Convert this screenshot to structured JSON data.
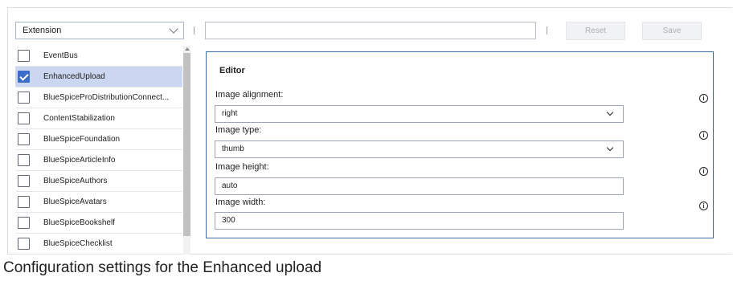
{
  "toolbar": {
    "select_value": "Extension",
    "search_value": "",
    "reset_label": "Reset",
    "save_label": "Save"
  },
  "list": {
    "items": [
      {
        "label": "EventBus",
        "checked": false
      },
      {
        "label": "EnhancedUpload",
        "checked": true
      },
      {
        "label": "BlueSpiceProDistributionConnect...",
        "checked": false
      },
      {
        "label": "ContentStabilization",
        "checked": false
      },
      {
        "label": "BlueSpiceFoundation",
        "checked": false
      },
      {
        "label": "BlueSpiceArticleInfo",
        "checked": false
      },
      {
        "label": "BlueSpiceAuthors",
        "checked": false
      },
      {
        "label": "BlueSpiceAvatars",
        "checked": false
      },
      {
        "label": "BlueSpiceBookshelf",
        "checked": false
      },
      {
        "label": "BlueSpiceChecklist",
        "checked": false
      }
    ]
  },
  "editor": {
    "title": "Editor",
    "fields": [
      {
        "label": "Image alignment:",
        "value": "right",
        "type": "dropdown"
      },
      {
        "label": "Image type:",
        "value": "thumb",
        "type": "dropdown"
      },
      {
        "label": "Image height:",
        "value": "auto",
        "type": "text"
      },
      {
        "label": "Image width:",
        "value": "300",
        "type": "text"
      }
    ],
    "info_icon": "info-circle-icon"
  },
  "caption": "Configuration settings for the Enhanced upload",
  "colors": {
    "selected_row": "#cbd7f0",
    "checkbox_checked": "#3a6ec8",
    "panel_border": "#3b6aa8"
  }
}
